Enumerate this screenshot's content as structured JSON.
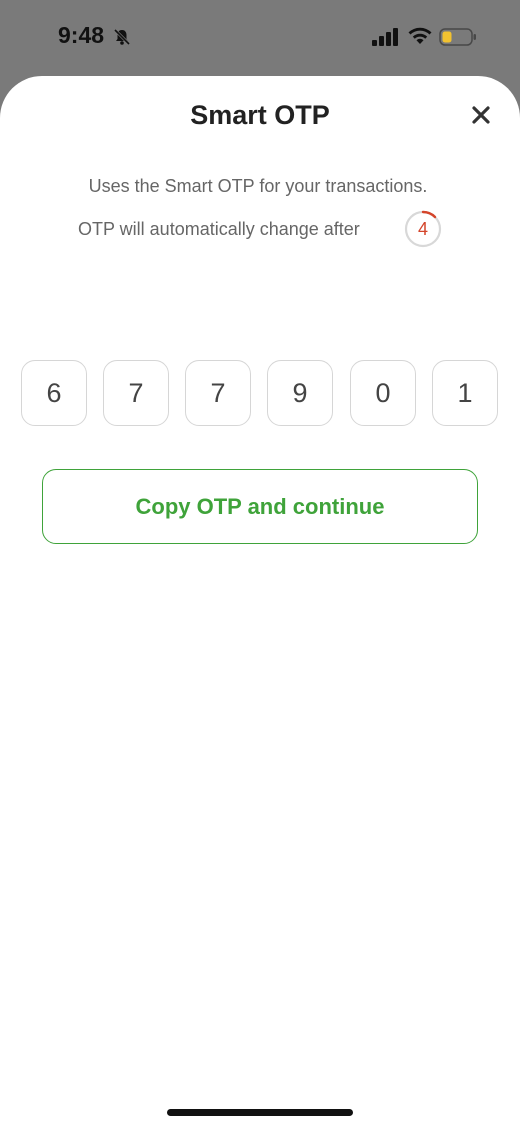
{
  "status_bar": {
    "time": "9:48",
    "icons": [
      "bell-slash-icon",
      "cellular-signal-icon",
      "wifi-icon",
      "battery-low-icon"
    ],
    "battery_color": "#f2c230"
  },
  "sheet": {
    "title": "Smart OTP",
    "close_icon": "close-icon",
    "description": "Uses the Smart OTP for your transactions.",
    "countdown_label": "OTP will automatically change after",
    "countdown_seconds": "4",
    "countdown_color": "#d4452b",
    "otp_digits": [
      "6",
      "7",
      "7",
      "9",
      "0",
      "1"
    ],
    "copy_button_label": "Copy OTP and continue",
    "accent_color": "#3fa33a"
  }
}
